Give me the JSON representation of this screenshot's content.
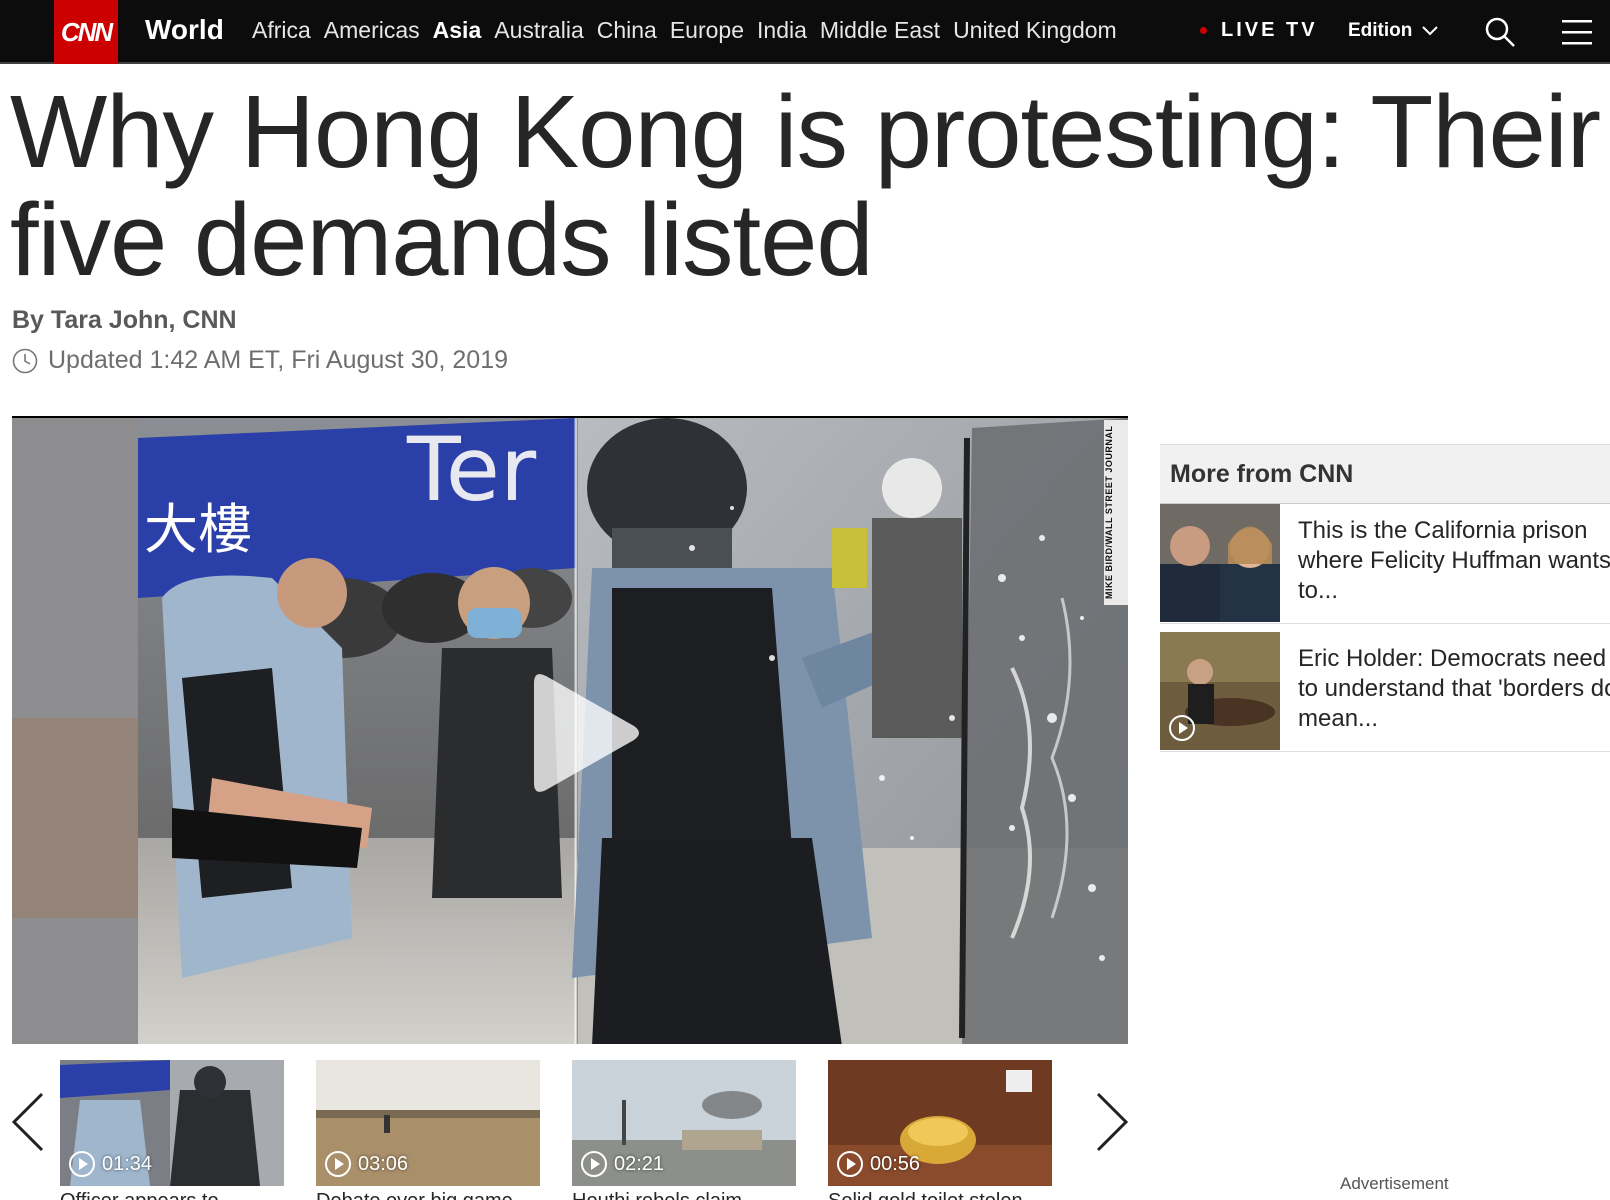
{
  "nav": {
    "logo": "CNN",
    "section": "World",
    "regions": [
      "Africa",
      "Americas",
      "Asia",
      "Australia",
      "China",
      "Europe",
      "India",
      "Middle East",
      "United Kingdom"
    ],
    "active_region": "Asia",
    "live_tv": "LIVE TV",
    "edition": "Edition"
  },
  "article": {
    "headline": "Why Hong Kong is protesting: Their five demands listed",
    "byline_prefix": "By ",
    "author": "Tara John, CNN",
    "updated": "Updated 1:42 AM ET, Fri August 30, 2019"
  },
  "video": {
    "credit": "MIKE BIRD/WALL STREET JOURNAL",
    "sign_text": "Ter",
    "sign_chinese": "大樓"
  },
  "carousel": {
    "items": [
      {
        "duration": "01:34",
        "caption": "Officer appears to"
      },
      {
        "duration": "03:06",
        "caption": "Debate over big game"
      },
      {
        "duration": "02:21",
        "caption": "Houthi rebels claim"
      },
      {
        "duration": "00:56",
        "caption": "Solid gold toilet stolen"
      }
    ]
  },
  "sidebar": {
    "title": "More from CNN",
    "stories": [
      {
        "text": "This is the California prison where Felicity Huffman wants to...",
        "has_video": false
      },
      {
        "text": "Eric Holder: Democrats need to understand that 'borders do mean...",
        "has_video": true
      }
    ],
    "advertisement": "Advertisement"
  },
  "colors": {
    "brand_red": "#cc0000",
    "nav_bg": "#0c0c0c",
    "text": "#262626"
  }
}
